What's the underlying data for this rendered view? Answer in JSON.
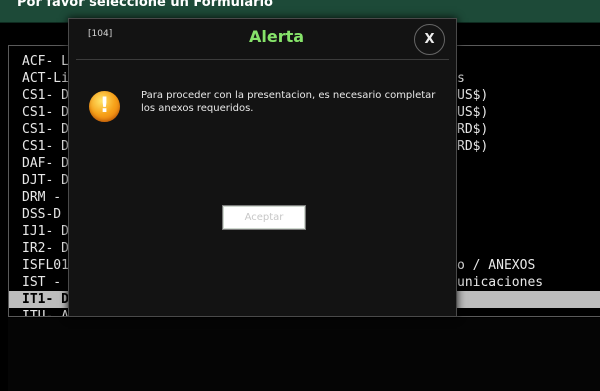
{
  "header": {
    "title": "Por favor seleccione un Formulario"
  },
  "form_list": {
    "items": [
      {
        "code": "ACF- Li",
        "tail": ""
      },
      {
        "code": "ACT-Li",
        "tail": "s"
      },
      {
        "code": "CS1- D",
        "tail": "US$)"
      },
      {
        "code": "CS1- D",
        "tail": "US$)"
      },
      {
        "code": "CS1- D",
        "tail": "RD$)"
      },
      {
        "code": "CS1- D",
        "tail": "RD$)"
      },
      {
        "code": "DAF- D",
        "tail": ""
      },
      {
        "code": "DJT- D",
        "tail": ""
      },
      {
        "code": "DRM -",
        "tail": ""
      },
      {
        "code": "DSS-D",
        "tail": ""
      },
      {
        "code": "IJ1- D",
        "tail": ""
      },
      {
        "code": "IR2- D",
        "tail": ""
      },
      {
        "code": "ISFL01",
        "tail": "o / ANEXOS"
      },
      {
        "code": "IST - D",
        "tail": "unicaciones"
      },
      {
        "code": "IT1- D",
        "tail": ""
      },
      {
        "code": "ITU- A",
        "tail": ""
      }
    ],
    "selected_index": 14
  },
  "alert": {
    "id": "[104]",
    "title": "Alerta",
    "close_label": "X",
    "icon": "warning-icon",
    "icon_glyph": "!",
    "message": "Para proceder con la presentacion, es necesario completar los anexos requeridos.",
    "accept_label": "Aceptar"
  },
  "colors": {
    "header_bg": "#1d4a38",
    "alert_title": "#86e36a",
    "modal_bg": "#131313",
    "selected_row": "#bdbdbd"
  }
}
